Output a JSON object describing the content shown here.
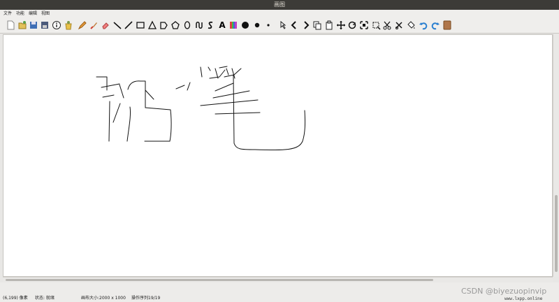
{
  "window": {
    "title": "画图"
  },
  "menu": {
    "items": [
      "文件",
      "功能",
      "编辑",
      "视图"
    ]
  },
  "toolbar": {
    "tools": [
      "new-file-icon",
      "open-file-icon",
      "save-icon",
      "save-as-icon",
      "info-icon",
      "bucket-icon",
      "pencil-icon",
      "brush-icon",
      "eraser-icon",
      "line-icon",
      "diagonal-line-icon",
      "rectangle-icon",
      "triangle-icon",
      "pentagon-icon",
      "hexagon-icon",
      "ellipse-icon",
      "curve-icon",
      "s-curve-icon",
      "text-icon",
      "palette-icon",
      "large-dot-icon",
      "medium-dot-icon",
      "small-dot-icon",
      "select-icon",
      "undo-arrow-icon",
      "redo-arrow-icon",
      "copy-icon",
      "paste-icon",
      "move-icon",
      "rotate-icon",
      "zoom-fit-icon",
      "crop-icon",
      "scissors-icon",
      "clear-icon",
      "fill-icon",
      "undo-icon",
      "redo-icon",
      "book-icon"
    ],
    "text_label": "A"
  },
  "status": {
    "coords": "(6,199) 像素",
    "state": "状态: 就绪",
    "canvas_size": "画布大小:2000 x 1000",
    "ops": "操作序列19/19"
  },
  "watermark": {
    "main": "CSDN @biyezuopinvip",
    "site": "www.lxpp.online"
  }
}
